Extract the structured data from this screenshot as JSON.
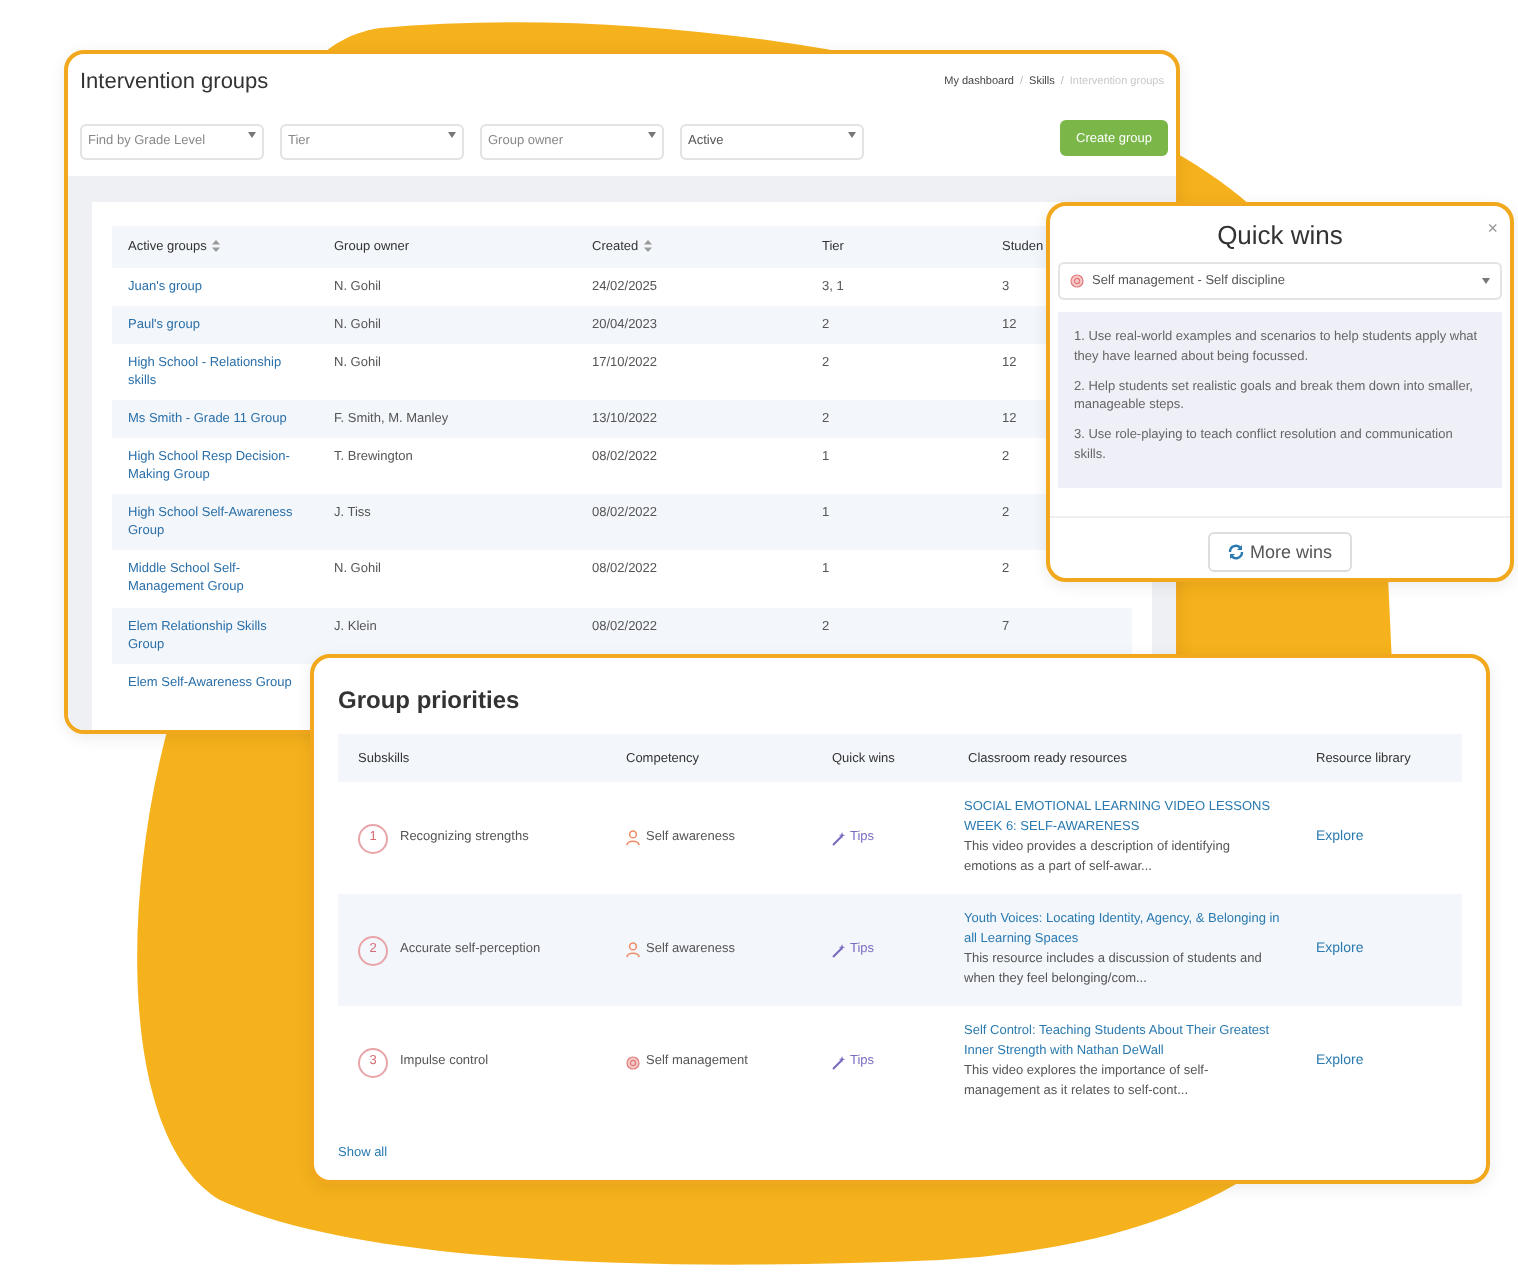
{
  "intervention_groups": {
    "title": "Intervention groups",
    "breadcrumb": {
      "separator": "/",
      "items": [
        {
          "label": "My dashboard",
          "current": false
        },
        {
          "label": "Skills",
          "current": false
        },
        {
          "label": "Intervention groups",
          "current": true
        }
      ]
    },
    "filters": [
      {
        "placeholder": "Find by Grade Level"
      },
      {
        "placeholder": "Tier"
      },
      {
        "placeholder": "Group owner"
      },
      {
        "value": "Active"
      }
    ],
    "create_button": "Create group",
    "table": {
      "columns": [
        {
          "label": "Active groups",
          "sortable": true
        },
        {
          "label": "Group owner",
          "sortable": false
        },
        {
          "label": "Created",
          "sortable": true
        },
        {
          "label": "Tier",
          "sortable": false
        },
        {
          "label": "Studen"
        }
      ],
      "rows": [
        {
          "name": "Juan's group",
          "owner": "N. Gohil",
          "created": "24/02/2025",
          "tier": "3, 1",
          "students": "3"
        },
        {
          "name": "Paul's group",
          "owner": "N. Gohil",
          "created": "20/04/2023",
          "tier": "2",
          "students": "12"
        },
        {
          "name": "High School - Relationship skills",
          "owner": "N. Gohil",
          "created": "17/10/2022",
          "tier": "2",
          "students": "12"
        },
        {
          "name": "Ms Smith - Grade 11 Group",
          "owner": "F. Smith, M. Manley",
          "created": "13/10/2022",
          "tier": "2",
          "students": "12"
        },
        {
          "name": "High School Resp Decision-Making Group",
          "owner": "T. Brewington",
          "created": "08/02/2022",
          "tier": "1",
          "students": "2"
        },
        {
          "name": "High School Self-Awareness Group",
          "owner": "J. Tiss",
          "created": "08/02/2022",
          "tier": "1",
          "students": "2"
        },
        {
          "name": "Middle School Self-Management Group",
          "owner": "N. Gohil",
          "created": "08/02/2022",
          "tier": "1",
          "students": "2"
        },
        {
          "name": "Elem Relationship Skills Group",
          "owner": "J. Klein",
          "created": "08/02/2022",
          "tier": "2",
          "students": "7"
        },
        {
          "name": "Elem Self-Awareness Group"
        }
      ]
    }
  },
  "quick_wins": {
    "title": "Quick wins",
    "close": "×",
    "select": {
      "value": "Self management - Self discipline",
      "kind": "management"
    },
    "tips": [
      "1. Use real-world examples and scenarios to help students apply what they have learned about being focussed.",
      "2. Help students set realistic goals and break them down into smaller, manageable steps.",
      "3. Use role-playing to teach conflict resolution and communication skills."
    ],
    "more_button": "More wins"
  },
  "group_priorities": {
    "title": "Group priorities",
    "columns": [
      "Subskills",
      "Competency",
      "Quick wins",
      "Classroom ready resources",
      "Resource library"
    ],
    "rows": [
      {
        "number": "1",
        "subskill": "Recognizing strengths",
        "competency": {
          "label": "Self awareness",
          "kind": "awareness"
        },
        "quick_wins": "Tips",
        "resource": {
          "title": "SOCIAL EMOTIONAL LEARNING VIDEO LESSONS WEEK 6: SELF-AWARENESS",
          "description": "This video provides a description of identifying emotions as a part of self-awar..."
        },
        "library": "Explore"
      },
      {
        "number": "2",
        "subskill": "Accurate self-perception",
        "competency": {
          "label": "Self awareness",
          "kind": "awareness"
        },
        "quick_wins": "Tips",
        "resource": {
          "title": "Youth Voices: Locating Identity, Agency, & Belonging in all Learning Spaces",
          "description": "This resource includes a discussion of students and when they feel belonging/com..."
        },
        "library": "Explore"
      },
      {
        "number": "3",
        "subskill": "Impulse control",
        "competency": {
          "label": "Self management",
          "kind": "management"
        },
        "quick_wins": "Tips",
        "resource": {
          "title": "Self Control: Teaching Students About Their Greatest Inner Strength with Nathan DeWall",
          "description": "This video explores the importance of self-management as it relates to self-cont..."
        },
        "library": "Explore"
      }
    ],
    "show_all": "Show all"
  }
}
